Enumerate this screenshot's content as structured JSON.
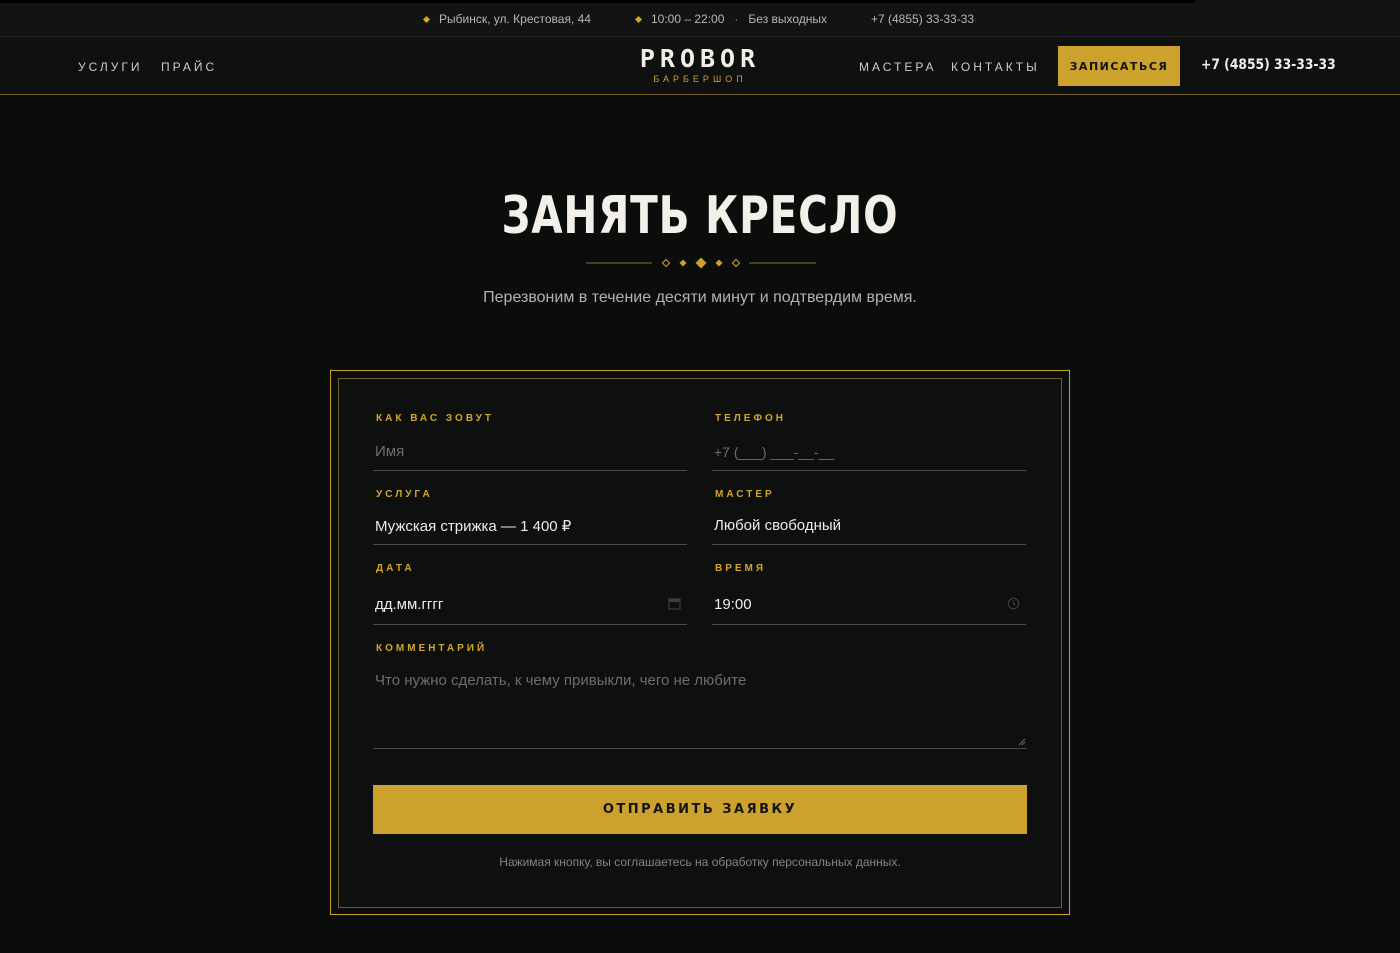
{
  "topbar": {
    "address": "Рыбинск, ул. Крестовая, 44",
    "hours": "10:00 – 22:00",
    "days": "Без выходных",
    "phone": "+7 (4855) 33-33-33"
  },
  "header": {
    "nav_left": [
      "УСЛУГИ",
      "ПРАЙС"
    ],
    "logo": "PROBOR",
    "logo_sub": "БАРБЕРШОП",
    "nav_right": [
      "МАСТЕРА",
      "КОНТАКТЫ"
    ],
    "cta": "ЗАПИСАТЬСЯ",
    "phone": "+7 (4855) 33-33-33"
  },
  "hero": {
    "title": "ЗАНЯТЬ КРЕСЛО",
    "subtitle": "Перезвоним в течение десяти минут и подтвердим время."
  },
  "form": {
    "name": {
      "label": "КАК ВАС ЗОВУТ",
      "placeholder": "Имя"
    },
    "phone": {
      "label": "ТЕЛЕФОН",
      "placeholder": "+7 (___) ___-__-__"
    },
    "service": {
      "label": "УСЛУГА",
      "value": "Мужская стрижка — 1 400 ₽"
    },
    "master": {
      "label": "МАСТЕР",
      "value": "Любой свободный"
    },
    "date": {
      "label": "ДАТА",
      "value": "дд.мм.гггг"
    },
    "time": {
      "label": "ВРЕМЯ",
      "value": "19:00"
    },
    "comment": {
      "label": "КОММЕНТАРИЙ",
      "placeholder": "Что нужно сделать, к чему привыкли, чего не любите"
    },
    "submit": "ОТПРАВИТЬ ЗАЯВКУ",
    "consent": "Нажимая кнопку, вы соглашаетесь на обработку персональных данных."
  },
  "colors": {
    "accent": "#cca22c",
    "background": "#0b0c0c"
  },
  "icons": [
    "calendar-icon",
    "clock-icon",
    "diamond-icon"
  ]
}
